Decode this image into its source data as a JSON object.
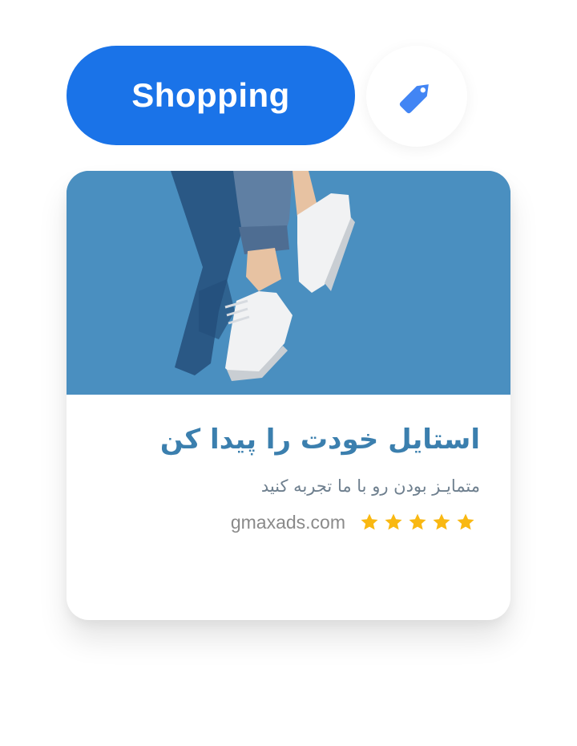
{
  "category": {
    "label": "Shopping",
    "icon": "tag-icon",
    "accent_color": "#1a73e8"
  },
  "ad": {
    "image": {
      "icon": "sneakers-photo",
      "background_color": "#4a8fc0"
    },
    "headline": "استایل خودت را پیدا کن",
    "description": "متمایـز بودن رو با ما تجربه کنید",
    "display_url": "gmaxads.com",
    "rating": {
      "value": 5,
      "max": 5,
      "star_color": "#f9b812"
    },
    "headline_color": "#3b7fae"
  }
}
